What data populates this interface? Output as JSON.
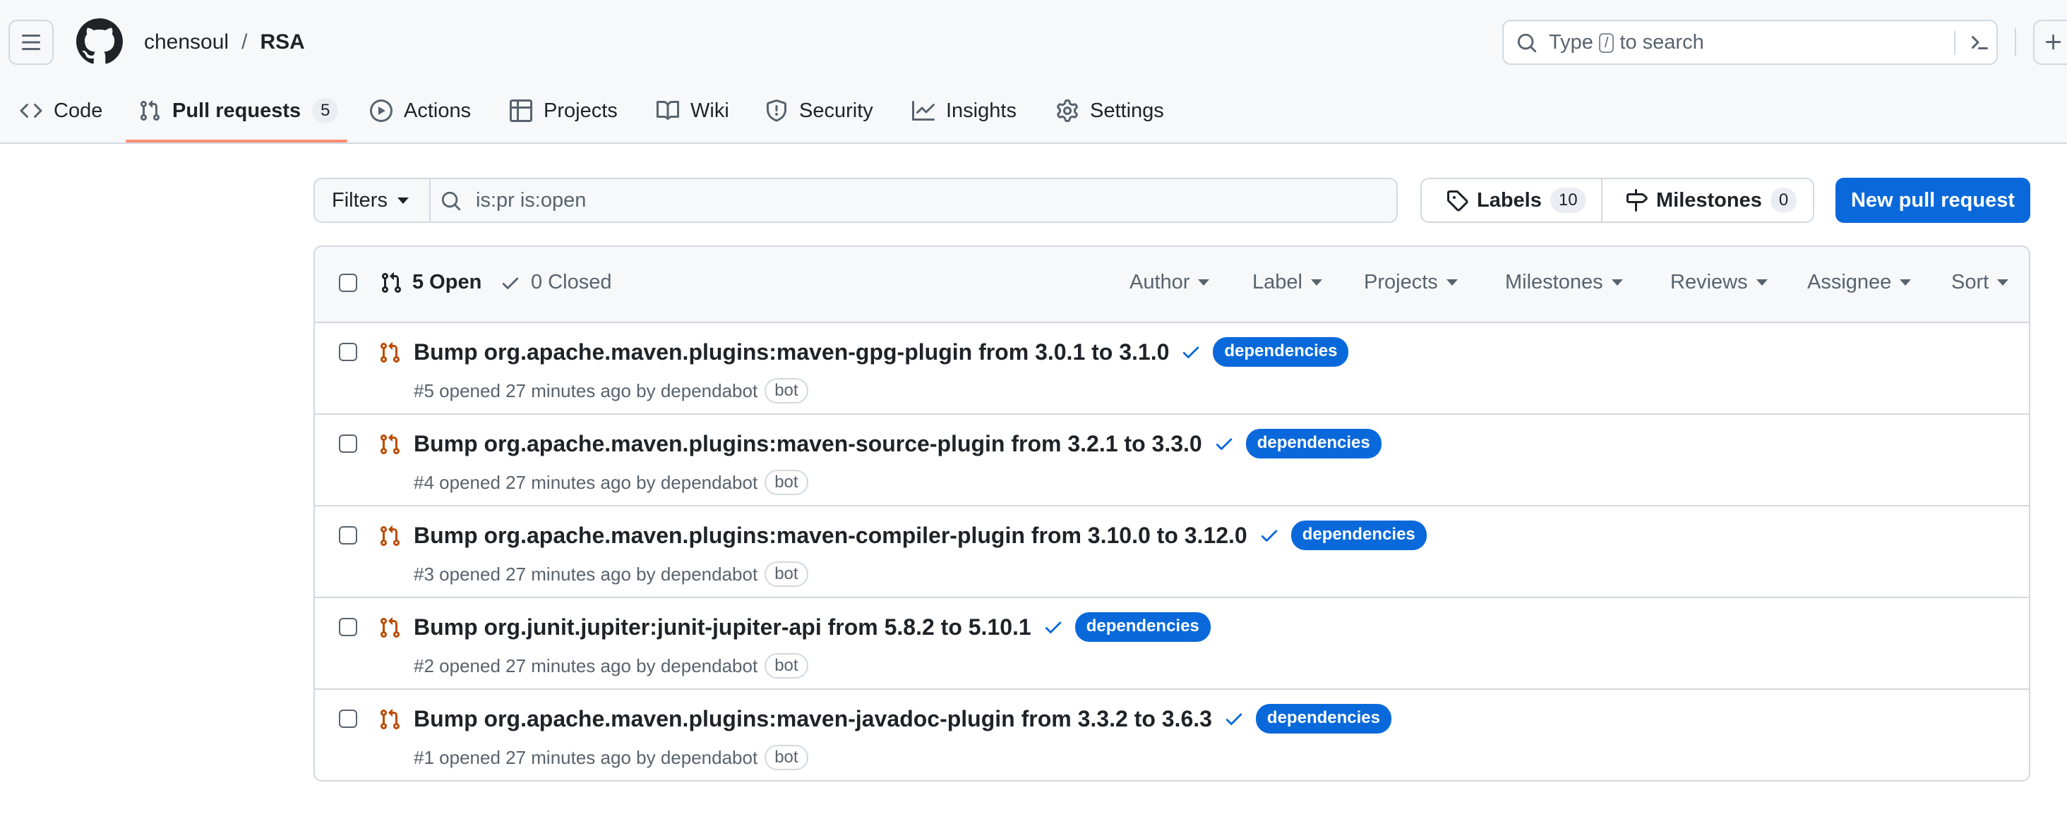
{
  "repo": {
    "owner": "chensoul",
    "separator": "/",
    "name": "RSA"
  },
  "search": {
    "prefix": "Type",
    "key": "/",
    "suffix": "to search"
  },
  "nav": {
    "code": "Code",
    "pull_requests": "Pull requests",
    "pull_requests_count": "5",
    "actions": "Actions",
    "projects": "Projects",
    "wiki": "Wiki",
    "security": "Security",
    "insights": "Insights",
    "settings": "Settings"
  },
  "toolbar": {
    "filters_label": "Filters",
    "filter_query": "is:pr is:open",
    "labels_label": "Labels",
    "labels_count": "10",
    "milestones_label": "Milestones",
    "milestones_count": "0",
    "new_pr_label": "New pull request"
  },
  "list_header": {
    "open_label": "5 Open",
    "closed_label": "0 Closed",
    "filters": [
      "Author",
      "Label",
      "Projects",
      "Milestones",
      "Reviews",
      "Assignee",
      "Sort"
    ]
  },
  "pull_requests": [
    {
      "title": "Bump org.apache.maven.plugins:maven-gpg-plugin from 3.0.1 to 3.1.0",
      "label": "dependencies",
      "meta": "#5 opened 27 minutes ago by dependabot",
      "author_badge": "bot"
    },
    {
      "title": "Bump org.apache.maven.plugins:maven-source-plugin from 3.2.1 to 3.3.0",
      "label": "dependencies",
      "meta": "#4 opened 27 minutes ago by dependabot",
      "author_badge": "bot"
    },
    {
      "title": "Bump org.apache.maven.plugins:maven-compiler-plugin from 3.10.0 to 3.12.0",
      "label": "dependencies",
      "meta": "#3 opened 27 minutes ago by dependabot",
      "author_badge": "bot"
    },
    {
      "title": "Bump org.junit.jupiter:junit-jupiter-api from 5.8.2 to 5.10.1",
      "label": "dependencies",
      "meta": "#2 opened 27 minutes ago by dependabot",
      "author_badge": "bot"
    },
    {
      "title": "Bump org.apache.maven.plugins:maven-javadoc-plugin from 3.3.2 to 3.6.3",
      "label": "dependencies",
      "meta": "#1 opened 27 minutes ago by dependabot",
      "author_badge": "bot"
    }
  ],
  "colors": {
    "accent": "#0969da",
    "pr_open": "#bc4c00",
    "underline": "#fd8c73",
    "border": "#d1d9e0"
  }
}
